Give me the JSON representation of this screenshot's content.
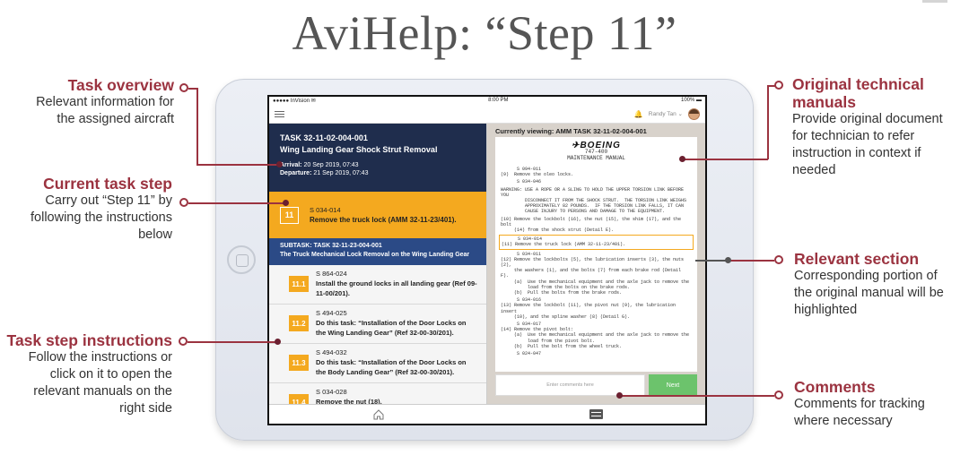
{
  "page_title": "AviHelp: “Step 11”",
  "annotations_left": [
    {
      "title": "Task overview",
      "desc": [
        "Relevant information for",
        "the assigned aircraft"
      ]
    },
    {
      "title": "Current task step",
      "desc": [
        "Carry out “Step 11” by",
        "following the instructions",
        "below"
      ]
    },
    {
      "title": "Task step instructions",
      "desc": [
        "Follow the instructions or",
        "click on it to open the",
        "relevant manuals on the",
        "right side"
      ]
    }
  ],
  "annotations_right": [
    {
      "title": [
        "Original technical",
        "manuals"
      ],
      "desc": [
        "Provide original document",
        "for technician to refer",
        "instruction in context if",
        "needed"
      ]
    },
    {
      "title": [
        "Relevant section"
      ],
      "desc": [
        "Corresponding portion of",
        "the original manual will be",
        "highlighted"
      ]
    },
    {
      "title": [
        "Comments"
      ],
      "desc": [
        "Comments for tracking",
        "where necessary"
      ]
    }
  ],
  "app": {
    "status_left": "●●●●● InVision ✉",
    "status_time": "8:00 PM",
    "status_right": "100% ▬",
    "user_name": "Randy Tan ⌄",
    "task": {
      "id": "TASK 32-11-02-004-001",
      "name": "Wing Landing Gear Shock Strut Removal",
      "arrival_label": "Arrival:",
      "arrival": "20 Sep 2019, 07:43",
      "departure_label": "Departure:",
      "departure": "21 Sep 2019, 07:43"
    },
    "current_step": {
      "num": "11",
      "code": "S 034-014",
      "desc": "Remove the truck lock (AMM 32-11-23/401)."
    },
    "subtask": {
      "line1": "SUBTASK: TASK 32-11-23-004-001",
      "line2": "The Truck Mechanical Lock Removal on the Wing Landing Gear"
    },
    "substeps": [
      {
        "num": "11.1",
        "code": "S 864-024",
        "desc": "Install the ground locks in all landing gear (Ref 09-11-00/201)."
      },
      {
        "num": "11.2",
        "code": "S 494-025",
        "desc": "Do this task: “Installation of the Door Locks on the Wing Landing Gear” (Ref 32-00-30/201)."
      },
      {
        "num": "11.3",
        "code": "S 494-032",
        "desc": "Do this task: “Installation of the Door Locks on the Body Landing Gear” (Ref 32-00-30/201)."
      },
      {
        "num": "11.4",
        "code": "S 034-028",
        "desc": "Remove the nut (18)."
      }
    ],
    "viewing": "Currently viewing: AMM TASK 32-11-02-004-001",
    "doc": {
      "brand": "✈BOEING",
      "model": "747-400",
      "manual": "MAINTENANCE MANUAL",
      "lines": [
        "      S 094-011\n(9)  Remove the oleo locks.",
        "      S 034-046",
        "WARNING: USE A ROPE OR A SLING TO HOLD THE UPPER TORSION LINK BEFORE YOU\n         DISCONNECT IT FROM THE SHOCK STRUT.  THE TORSION LINK WEIGHS\n         APPROXIMATELY 82 POUNDS.  IF THE TORSION LINK FALLS, IT CAN\n         CAUSE INJURY TO PERSONS AND DAMAGE TO THE EQUIPMENT.",
        "(10) Remove the lockbolt (16), the nut (15), the shim (17), and the bolt\n     (14) from the shock strut (Detail E)."
      ],
      "highlight": "      S 034-014\n(11) Remove the truck lock (AMM 32-11-23/401).",
      "lines_after": [
        "      S 034-011\n(12) Remove the lockbolts (5), the lubrication inserts (3), the nuts (2),\n     the washers (1), and the bolts (7) from each brake rod (Detail F).\n     (a)  Use the mechanical equipment and the axle jack to remove the\n          load from the bolts on the brake rods.\n     (b)  Pull the bolts from the brake rods.",
        "      S 034-016\n(13) Remove the lockbolt (11), the pivot nut (9), the lubrication insert\n     (10), and the spline washer (8) (Detail G).",
        "      S 034-017\n(14) Remove the pivot bolt:\n     (a)  Use the mechanical equipment and the axle jack to remove the\n          load from the pivot bolt.\n     (b)  Pull the bolt from the wheel truck.",
        "      S 024-047"
      ]
    },
    "comment_placeholder": "Enter comments here",
    "next_label": "Next"
  }
}
